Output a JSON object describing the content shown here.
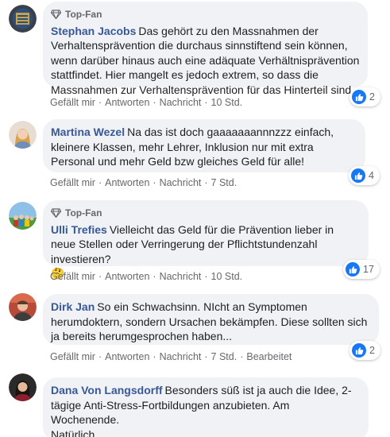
{
  "badges": {
    "top_fan_label": "Top-Fan"
  },
  "actions": {
    "like": "Gefällt mir",
    "reply": "Antworten",
    "message": "Nachricht",
    "edited": "Bearbeitet",
    "separator": "·"
  },
  "comments": [
    {
      "author": "Stephan Jacobs",
      "text": "Das gehört zu den Massnahmen der Verhaltensprävention die durchaus sinnstiftend sein können, wenn darüber hinaus auch eine adäquate Verhältnisprävention stattfindet. Hier mangelt es jedoch extrem, so dass die Massnahmen zur Verhaltensprävention für das Hinterteil sind.",
      "time": "10 Std.",
      "reactions": "2"
    },
    {
      "author": "Martina Wezel",
      "text": "Na das ist doch gaaaaaaannnzzz einfach, kleinere Klassen, mehr Lehrer, Inklusion nur mit extra Personal und mehr Geld bzw gleiches Geld für alle!",
      "time": "7 Std.",
      "reactions": "4"
    },
    {
      "author": "Ulli Trefies",
      "text": "Vielleicht das Geld für die Prävention lieber in neue Stellen oder Verringerung der Pflichtstundenzahl investieren?",
      "emoji": "🤔",
      "time": "10 Std.",
      "reactions": "17"
    },
    {
      "author": "Dirk Jan",
      "text": "So ein Schwachsinn. NIcht an Symptomen herumdoktern, sondern Ursachen bekämpfen. Diese sollten sich ja bereits herumgesprochen haben...",
      "time": "7 Std.",
      "reactions": "2"
    },
    {
      "author": "Dana Von Langsdorff",
      "text": "Besonders süß ist ja auch die Idee, 2-tägige Anti-Stress-Fortbildungen anzubieten. Am Wochenende.",
      "text2": "Natürlich."
    }
  ]
}
